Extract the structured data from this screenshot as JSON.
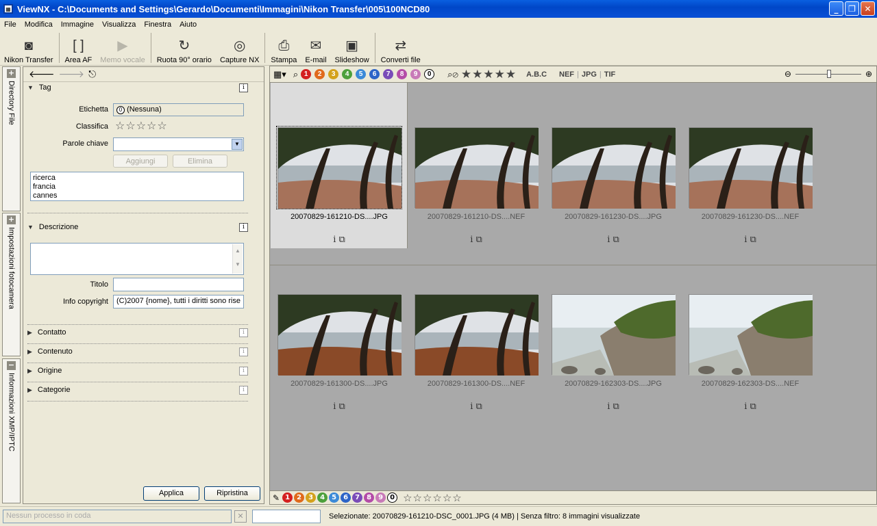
{
  "window": {
    "title": "ViewNX - C:\\Documents and Settings\\Gerardo\\Documenti\\Immagini\\Nikon Transfer\\005\\100NCD80"
  },
  "menu": [
    "File",
    "Modifica",
    "Immagine",
    "Visualizza",
    "Finestra",
    "Aiuto"
  ],
  "toolbar": [
    {
      "label": "Nikon Transfer",
      "icon": "camera-icon",
      "enabled": true
    },
    {
      "label": "Area AF",
      "icon": "af-area-icon",
      "enabled": true
    },
    {
      "label": "Memo vocale",
      "icon": "voice-memo-icon",
      "enabled": false
    },
    {
      "label": "Ruota 90° orario",
      "icon": "rotate-cw-icon",
      "enabled": true
    },
    {
      "label": "Capture NX",
      "icon": "capture-nx-icon",
      "enabled": true
    },
    {
      "label": "Stampa",
      "icon": "print-icon",
      "enabled": true
    },
    {
      "label": "E-mail",
      "icon": "email-icon",
      "enabled": true
    },
    {
      "label": "Slideshow",
      "icon": "slideshow-icon",
      "enabled": true
    },
    {
      "label": "Converti file",
      "icon": "convert-icon",
      "enabled": true
    }
  ],
  "side_tabs": [
    "Directory File",
    "Impostazioni fotocamera",
    "Informazioni XMP/IPTC"
  ],
  "tag": {
    "header": "Tag",
    "label_etichetta": "Etichetta",
    "etichetta_value": "(Nessuna)",
    "etichetta_num": "0",
    "label_classifica": "Classifica",
    "rating": 0,
    "label_parole": "Parole chiave",
    "btn_add": "Aggiungi",
    "btn_del": "Elimina",
    "keywords": [
      "ricerca",
      "francia",
      "cannes"
    ]
  },
  "descr": {
    "header": "Descrizione",
    "label_titolo": "Titolo",
    "label_copyright": "Info copyright",
    "copyright_value": "(C)2007 {nome}, tutti i diritti sono rise"
  },
  "collapsed": [
    "Contatto",
    "Contenuto",
    "Origine",
    "Categorie"
  ],
  "buttons": {
    "apply": "Applica",
    "reset": "Ripristina"
  },
  "filter": {
    "labels": [
      "1",
      "2",
      "3",
      "4",
      "5",
      "6",
      "7",
      "8",
      "9",
      "0"
    ],
    "label_colors": [
      "#d42020",
      "#e06a1c",
      "#d4a21c",
      "#4ca03c",
      "#3c8ad8",
      "#2c64c8",
      "#7a4cb8",
      "#b44ca8",
      "#c87ab8",
      "#ffffff"
    ],
    "text_filter": "A.B.C",
    "formats": [
      "NEF",
      "JPG",
      "TIF"
    ]
  },
  "thumbnails": [
    {
      "name": "20070829-161210-DS....JPG",
      "scene": "trees",
      "selected": true
    },
    {
      "name": "20070829-161210-DS....NEF",
      "scene": "trees",
      "selected": false
    },
    {
      "name": "20070829-161230-DS....JPG",
      "scene": "trees",
      "selected": false
    },
    {
      "name": "20070829-161230-DS....NEF",
      "scene": "trees",
      "selected": false
    },
    {
      "name": "20070829-161300-DS....JPG",
      "scene": "trees2",
      "selected": false
    },
    {
      "name": "20070829-161300-DS....NEF",
      "scene": "trees2",
      "selected": false
    },
    {
      "name": "20070829-162303-DS....JPG",
      "scene": "coast",
      "selected": false
    },
    {
      "name": "20070829-162303-DS....NEF",
      "scene": "coast",
      "selected": false
    }
  ],
  "status": {
    "queue": "Nessun processo in coda",
    "info": "Selezionate: 20070829-161210-DSC_0001.JPG (4 MB) | Senza filtro: 8 immagini visualizzate"
  }
}
